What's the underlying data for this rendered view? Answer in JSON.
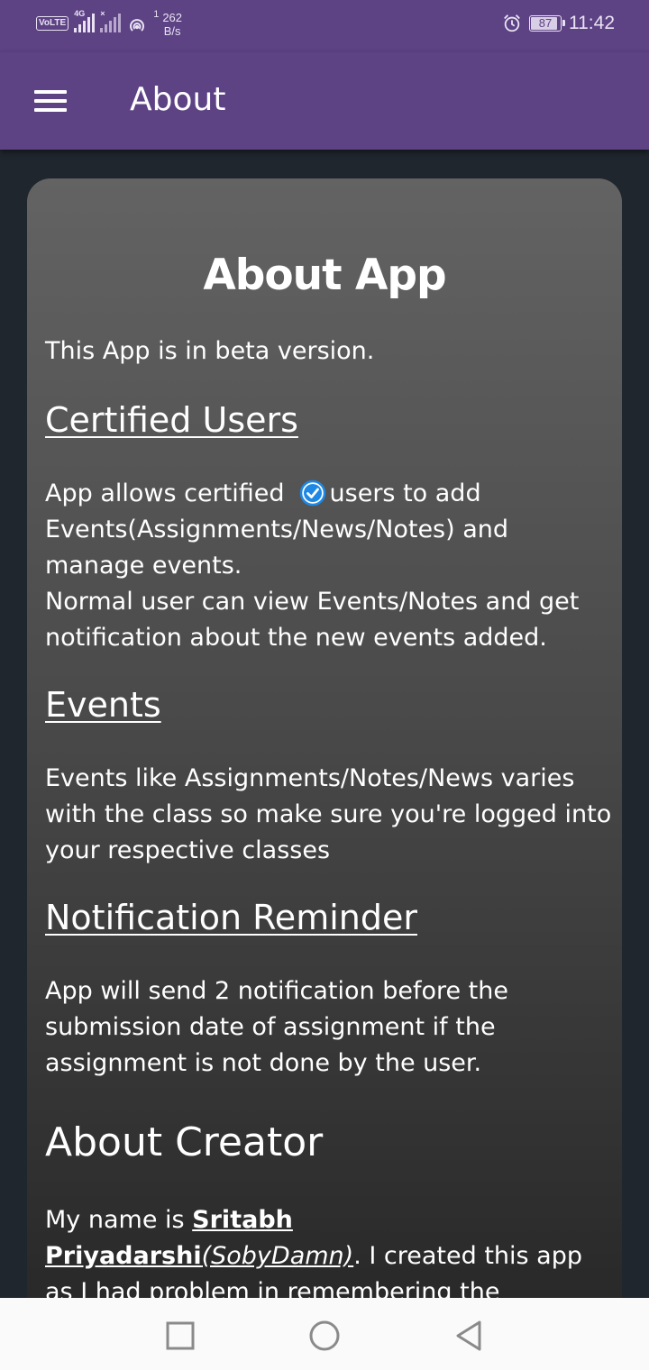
{
  "status_bar": {
    "volte": "VoLTE",
    "network_type": "4G",
    "hotspot_count": "1",
    "speed_value": "262",
    "speed_unit": "B/s",
    "battery": "87",
    "time": "11:42",
    "icons": [
      "signal-icon",
      "signal-off-icon",
      "hotspot-icon",
      "alarm-icon",
      "battery-icon"
    ]
  },
  "app_bar": {
    "title": "About",
    "menu_icon": "hamburger-menu-icon",
    "color": "#5d4284"
  },
  "content": {
    "title": "About App",
    "intro": "This App is in beta version.",
    "sections": [
      {
        "heading": "Certified Users",
        "body_before_icon": "App allows certified",
        "icon": "verified-check-icon",
        "body_after_icon": "users to add Events(Assignments/News/Notes) and manage events.",
        "body_line2": "Normal user can view Events/Notes and get notification about the new events added."
      },
      {
        "heading": "Events",
        "body": "Events like Assignments/Notes/News varies with the class so make sure you're logged into your respective classes"
      },
      {
        "heading": "Notification Reminder",
        "body": "App will send 2 notification before the submission date of assignment if the assignment is not done by the user."
      }
    ],
    "creator": {
      "heading": "About Creator",
      "text_start": "My name is ",
      "name": "Sritabh Priyadarshi",
      "alias": "(SobyDamn)",
      "text_end": ". I created this app as I had problem in remembering the submission dates of"
    },
    "check_color": "#1e88e5"
  },
  "nav_bar": {
    "buttons": [
      "recents-square-icon",
      "home-circle-icon",
      "back-triangle-icon"
    ]
  }
}
